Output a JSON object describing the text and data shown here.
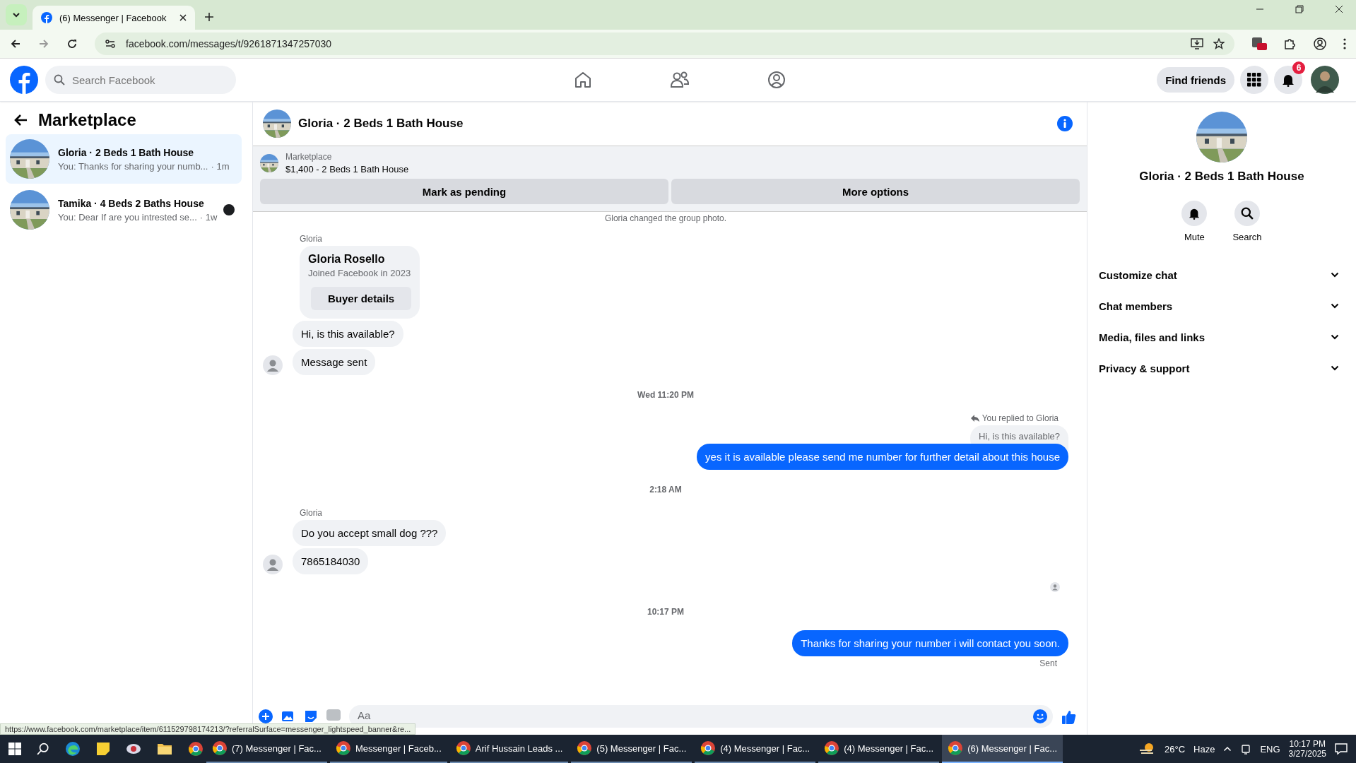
{
  "browser": {
    "tabs": [
      {
        "title": "(6) Messenger | Facebook",
        "selected": true
      }
    ],
    "url": "facebook.com/messages/t/9261871347257030",
    "status_url": "https://www.facebook.com/marketplace/item/611529798174213/?referralSurface=messenger_lightspeed_banner&re..."
  },
  "header": {
    "search_placeholder": "Search Facebook",
    "find_friends": "Find friends",
    "notification_count": "6"
  },
  "sidebar": {
    "title": "Marketplace",
    "conversations": [
      {
        "name": "Gloria · 2 Beds 1 Bath House",
        "preview": "You: Thanks for sharing your numb...",
        "time": "· 1m",
        "selected": true,
        "seen_avatar": false
      },
      {
        "name": "Tamika · 4 Beds 2 Baths House",
        "preview": "You: Dear If are you intrested se...",
        "time": "· 1w",
        "selected": false,
        "seen_avatar": true
      }
    ]
  },
  "chat": {
    "title": "Gloria · 2 Beds 1 Bath House",
    "listing": {
      "label": "Marketplace",
      "title": "$1,400 - 2 Beds 1 Bath House"
    },
    "actions": [
      "Mark as pending",
      "More options"
    ],
    "messages": [
      {
        "kind": "system",
        "text": "Gloria changed the group photo."
      },
      {
        "kind": "sender",
        "text": "Gloria"
      },
      {
        "kind": "card",
        "name": "Gloria Rosello",
        "detail": "Joined Facebook in 2023",
        "button": "Buyer details"
      },
      {
        "kind": "incoming",
        "text": "Hi, is this available?",
        "avatar": false
      },
      {
        "kind": "incoming",
        "text": "Message sent",
        "avatar": true
      },
      {
        "kind": "time",
        "text": "Wed 11:20 PM"
      },
      {
        "kind": "reply_note",
        "text": "You replied to Gloria"
      },
      {
        "kind": "quote",
        "text": "Hi, is this available?"
      },
      {
        "kind": "outgoing",
        "text": "yes it is available please send me number for further detail about this house"
      },
      {
        "kind": "time",
        "text": "2:18 AM"
      },
      {
        "kind": "sender",
        "text": "Gloria"
      },
      {
        "kind": "incoming",
        "text": "Do you accept small dog ???",
        "avatar": false
      },
      {
        "kind": "incoming",
        "text": "7865184030",
        "avatar": true
      },
      {
        "kind": "seen"
      },
      {
        "kind": "time",
        "text": "10:17 PM"
      },
      {
        "kind": "outgoing",
        "text": "Thanks for sharing your number i will contact you soon."
      },
      {
        "kind": "status",
        "text": "Sent"
      }
    ],
    "composer_placeholder": "Aa"
  },
  "details": {
    "name": "Gloria · 2 Beds 1 Bath House",
    "actions": [
      {
        "kind": "mute",
        "label": "Mute"
      },
      {
        "kind": "search",
        "label": "Search"
      }
    ],
    "sections": [
      "Customize chat",
      "Chat members",
      "Media, files and links",
      "Privacy & support"
    ]
  },
  "taskbar": {
    "windows": [
      {
        "title": "(7) Messenger | Fac...",
        "selected": false
      },
      {
        "title": "Messenger | Faceb...",
        "selected": false
      },
      {
        "title": "Arif Hussain Leads ...",
        "selected": false
      },
      {
        "title": "(5) Messenger | Fac...",
        "selected": false
      },
      {
        "title": "(4) Messenger | Fac...",
        "selected": false
      },
      {
        "title": "(4) Messenger | Fac...",
        "selected": false
      },
      {
        "title": "(6) Messenger | Fac...",
        "selected": true
      }
    ],
    "temperature": "26°C",
    "weather": "Haze",
    "language": "ENG",
    "time": "10:17 PM",
    "date": "3/27/2025"
  }
}
